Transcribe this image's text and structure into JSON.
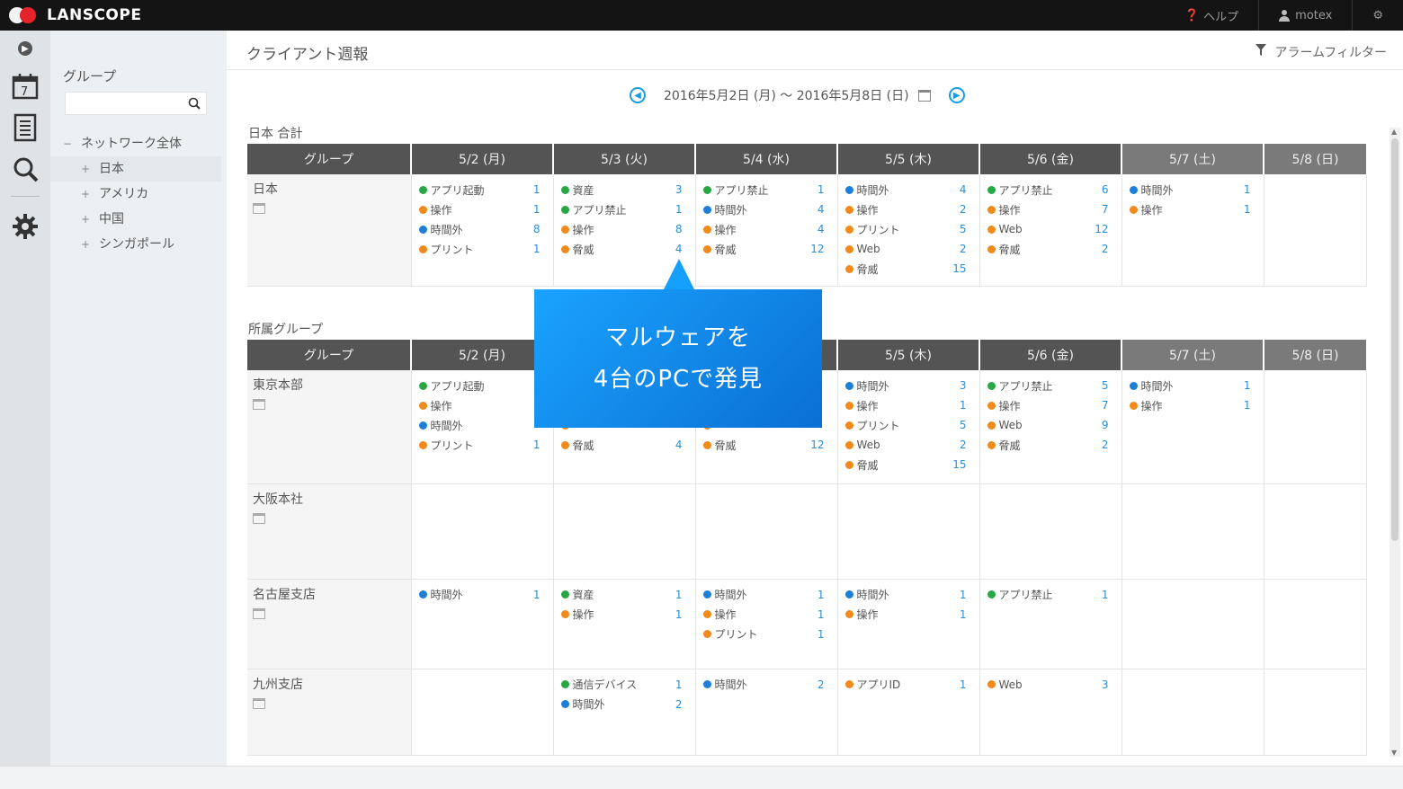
{
  "app": {
    "logo": "LANSCOPE"
  },
  "topbar": {
    "help": "ヘルプ",
    "user": "motex"
  },
  "sidebar": {
    "group_title": "グループ",
    "search_placeholder": "",
    "tree": [
      {
        "label": "ネットワーク全体",
        "level": 0,
        "marker": "−"
      },
      {
        "label": "日本",
        "level": 1,
        "marker": "+",
        "selected": true
      },
      {
        "label": "アメリカ",
        "level": 1,
        "marker": "+"
      },
      {
        "label": "中国",
        "level": 1,
        "marker": "+"
      },
      {
        "label": "シンガポール",
        "level": 1,
        "marker": "+"
      }
    ]
  },
  "main": {
    "title": "クライアント週報",
    "filter": "アラームフィルター",
    "date_range": "2016年5月2日 (月) 〜 2016年5月8日 (日)",
    "columns": [
      "グループ",
      "5/2 (月)",
      "5/3 (火)",
      "5/4 (水)",
      "5/5 (木)",
      "5/6 (金)",
      "5/7 (土)",
      "5/8 (日)"
    ]
  },
  "sections": [
    {
      "label": "日本 合計",
      "rows": [
        {
          "group": "日本",
          "days": [
            [
              {
                "c": "green",
                "l": "アプリ起動",
                "n": "1"
              },
              {
                "c": "orange",
                "l": "操作",
                "n": "1"
              },
              {
                "c": "blue",
                "l": "時間外",
                "n": "8"
              },
              {
                "c": "orange",
                "l": "プリント",
                "n": "1"
              }
            ],
            [
              {
                "c": "green",
                "l": "資産",
                "n": "3"
              },
              {
                "c": "green",
                "l": "アプリ禁止",
                "n": "1"
              },
              {
                "c": "orange",
                "l": "操作",
                "n": "8"
              },
              {
                "c": "orange",
                "l": "脅威",
                "n": "4"
              }
            ],
            [
              {
                "c": "green",
                "l": "アプリ禁止",
                "n": "1"
              },
              {
                "c": "blue",
                "l": "時間外",
                "n": "4"
              },
              {
                "c": "orange",
                "l": "操作",
                "n": "4"
              },
              {
                "c": "orange",
                "l": "脅威",
                "n": "12"
              }
            ],
            [
              {
                "c": "blue",
                "l": "時間外",
                "n": "4"
              },
              {
                "c": "orange",
                "l": "操作",
                "n": "2"
              },
              {
                "c": "orange",
                "l": "プリント",
                "n": "5"
              },
              {
                "c": "orange",
                "l": "Web",
                "n": "2"
              },
              {
                "c": "orange",
                "l": "脅威",
                "n": "15"
              }
            ],
            [
              {
                "c": "green",
                "l": "アプリ禁止",
                "n": "6"
              },
              {
                "c": "orange",
                "l": "操作",
                "n": "7"
              },
              {
                "c": "orange",
                "l": "Web",
                "n": "12"
              },
              {
                "c": "orange",
                "l": "脅威",
                "n": "2"
              }
            ],
            [
              {
                "c": "blue",
                "l": "時間外",
                "n": "1"
              },
              {
                "c": "orange",
                "l": "操作",
                "n": "1"
              }
            ],
            []
          ]
        }
      ]
    },
    {
      "label": "所属グループ",
      "rows": [
        {
          "group": "東京本部",
          "days": [
            [
              {
                "c": "green",
                "l": "アプリ起動",
                "n": ""
              },
              {
                "c": "orange",
                "l": "操作",
                "n": ""
              },
              {
                "c": "blue",
                "l": "時間外",
                "n": ""
              },
              {
                "c": "orange",
                "l": "プリント",
                "n": "1"
              }
            ],
            [
              {
                "c": "green",
                "l": "",
                "n": ""
              },
              {
                "c": "green",
                "l": "",
                "n": ""
              },
              {
                "c": "orange",
                "l": "",
                "n": ""
              },
              {
                "c": "orange",
                "l": "脅威",
                "n": "4"
              }
            ],
            [
              {
                "c": "green",
                "l": "",
                "n": ""
              },
              {
                "c": "blue",
                "l": "",
                "n": ""
              },
              {
                "c": "orange",
                "l": "",
                "n": ""
              },
              {
                "c": "orange",
                "l": "脅威",
                "n": "12"
              }
            ],
            [
              {
                "c": "blue",
                "l": "時間外",
                "n": "3"
              },
              {
                "c": "orange",
                "l": "操作",
                "n": "1"
              },
              {
                "c": "orange",
                "l": "プリント",
                "n": "5"
              },
              {
                "c": "orange",
                "l": "Web",
                "n": "2"
              },
              {
                "c": "orange",
                "l": "脅威",
                "n": "15"
              }
            ],
            [
              {
                "c": "green",
                "l": "アプリ禁止",
                "n": "5"
              },
              {
                "c": "orange",
                "l": "操作",
                "n": "7"
              },
              {
                "c": "orange",
                "l": "Web",
                "n": "9"
              },
              {
                "c": "orange",
                "l": "脅威",
                "n": "2"
              }
            ],
            [
              {
                "c": "blue",
                "l": "時間外",
                "n": "1"
              },
              {
                "c": "orange",
                "l": "操作",
                "n": "1"
              }
            ],
            []
          ]
        },
        {
          "group": "大阪本社",
          "days": [
            [],
            [],
            [],
            [],
            [],
            [],
            []
          ]
        },
        {
          "group": "名古屋支店",
          "days": [
            [
              {
                "c": "blue",
                "l": "時間外",
                "n": "1"
              }
            ],
            [
              {
                "c": "green",
                "l": "資産",
                "n": "1"
              },
              {
                "c": "orange",
                "l": "操作",
                "n": "1"
              }
            ],
            [
              {
                "c": "blue",
                "l": "時間外",
                "n": "1"
              },
              {
                "c": "orange",
                "l": "操作",
                "n": "1"
              },
              {
                "c": "orange",
                "l": "プリント",
                "n": "1"
              }
            ],
            [
              {
                "c": "blue",
                "l": "時間外",
                "n": "1"
              },
              {
                "c": "orange",
                "l": "操作",
                "n": "1"
              }
            ],
            [
              {
                "c": "green",
                "l": "アプリ禁止",
                "n": "1"
              }
            ],
            [],
            []
          ]
        },
        {
          "group": "九州支店",
          "days": [
            [],
            [
              {
                "c": "green",
                "l": "通信デバイス",
                "n": "1"
              },
              {
                "c": "blue",
                "l": "時間外",
                "n": "2"
              }
            ],
            [
              {
                "c": "blue",
                "l": "時間外",
                "n": "2"
              }
            ],
            [
              {
                "c": "orange",
                "l": "アプリID",
                "n": "1"
              }
            ],
            [
              {
                "c": "orange",
                "l": "Web",
                "n": "3"
              }
            ],
            [],
            []
          ]
        }
      ]
    }
  ],
  "callout": {
    "line1": "マルウェアを",
    "line2": "4台のPCで発見"
  },
  "colors": {
    "green": "#27a844",
    "orange": "#f08a1c",
    "blue": "#1e7fd6",
    "accent": "#1a9be0"
  }
}
